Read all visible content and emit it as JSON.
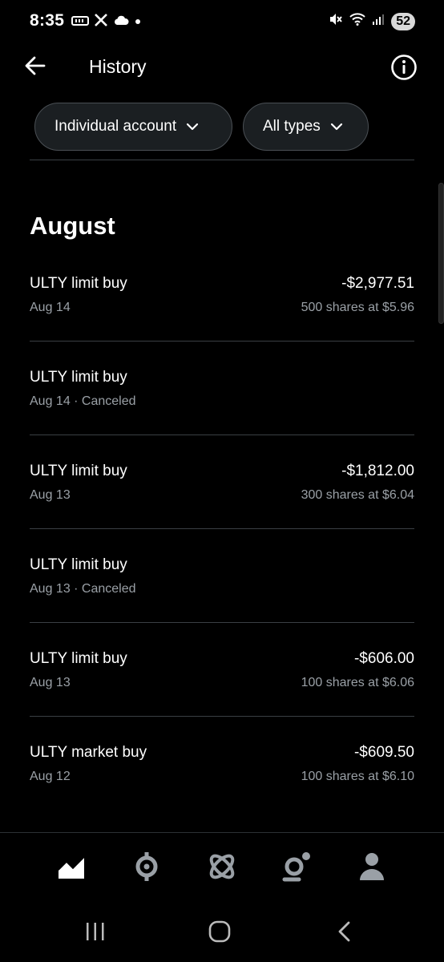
{
  "status_bar": {
    "time": "8:35",
    "battery": "52",
    "left_icons": [
      "voicemail-icon",
      "x-app-icon",
      "cloud-icon",
      "dot-icon"
    ],
    "right_icons": [
      "mute-icon",
      "wifi-icon",
      "signal-icon"
    ]
  },
  "header": {
    "title": "History"
  },
  "filters": {
    "account_label": "Individual account",
    "types_label": "All types"
  },
  "section": {
    "title": "August"
  },
  "transactions": [
    {
      "name": "ULTY limit buy",
      "date": "Aug 14",
      "status": "",
      "sub": "Aug 14",
      "amount": "-$2,977.51",
      "detail": "500 shares at $5.96"
    },
    {
      "name": "ULTY limit buy",
      "date": "Aug 14",
      "status": "Canceled",
      "sub": "Aug 14 · Canceled",
      "amount": "",
      "detail": ""
    },
    {
      "name": "ULTY limit buy",
      "date": "Aug 13",
      "status": "",
      "sub": "Aug 13",
      "amount": "-$1,812.00",
      "detail": "300 shares at $6.04"
    },
    {
      "name": "ULTY limit buy",
      "date": "Aug 13",
      "status": "Canceled",
      "sub": "Aug 13 · Canceled",
      "amount": "",
      "detail": ""
    },
    {
      "name": "ULTY limit buy",
      "date": "Aug 13",
      "status": "",
      "sub": "Aug 13",
      "amount": "-$606.00",
      "detail": "100 shares at $6.06"
    },
    {
      "name": "ULTY market buy",
      "date": "Aug 12",
      "status": "",
      "sub": "Aug 12",
      "amount": "-$609.50",
      "detail": "100 shares at $6.10"
    }
  ],
  "bottom_nav": [
    "investing-chart-icon",
    "crypto-icon",
    "discover-icon",
    "notifications-icon",
    "account-icon"
  ],
  "colors": {
    "background": "#000000",
    "chip_background": "#1b1f22",
    "chip_border": "#4a4f54",
    "divider": "#3a3f44",
    "secondary_text": "#9aa0a6"
  }
}
